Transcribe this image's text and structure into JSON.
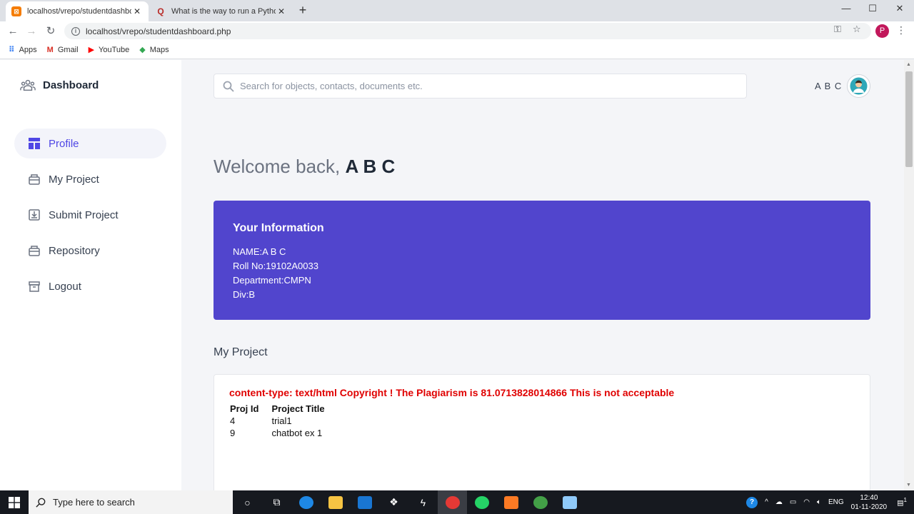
{
  "browser": {
    "tabs": [
      {
        "title": "localhost/vrepo/studentdashboa",
        "active": true
      },
      {
        "title": "What is the way to run a Python",
        "active": false
      }
    ],
    "url": "localhost/vrepo/studentdashboard.php",
    "profile_initial": "P",
    "bookmarks": [
      {
        "label": "Apps",
        "icon": "apps-grid-icon"
      },
      {
        "label": "Gmail",
        "icon": "gmail-icon"
      },
      {
        "label": "YouTube",
        "icon": "youtube-icon"
      },
      {
        "label": "Maps",
        "icon": "maps-icon"
      }
    ]
  },
  "sidebar": {
    "brand": "Dashboard",
    "items": [
      {
        "label": "Profile",
        "icon": "layout-icon",
        "active": true
      },
      {
        "label": "My Project",
        "icon": "briefcase-icon",
        "active": false
      },
      {
        "label": "Submit Project",
        "icon": "submit-icon",
        "active": false
      },
      {
        "label": "Repository",
        "icon": "repository-icon",
        "active": false
      },
      {
        "label": "Logout",
        "icon": "archive-icon",
        "active": false
      }
    ]
  },
  "header": {
    "search_placeholder": "Search for objects, contacts, documents etc.",
    "user_name": "A B C"
  },
  "welcome": {
    "prefix": "Welcome back,",
    "name": "A B C"
  },
  "info_card": {
    "title": "Your Information",
    "lines": [
      "NAME:A B C",
      "Roll No:19102A0033",
      "Department:CMPN",
      "Div:B"
    ],
    "background": "#5145cd"
  },
  "projects": {
    "section_title": "My Project",
    "error_message": "content-type: text/html Copyright ! The Plagiarism is 81.0713828014866 This is not acceptable",
    "columns": [
      "Proj Id",
      "Project Title"
    ],
    "rows": [
      [
        "4",
        "trial1"
      ],
      [
        "9",
        "chatbot ex 1"
      ]
    ]
  },
  "taskbar": {
    "search_placeholder": "Type here to search",
    "language": "ENG",
    "time": "12:40",
    "date": "01-11-2020",
    "notification_count": "1"
  }
}
